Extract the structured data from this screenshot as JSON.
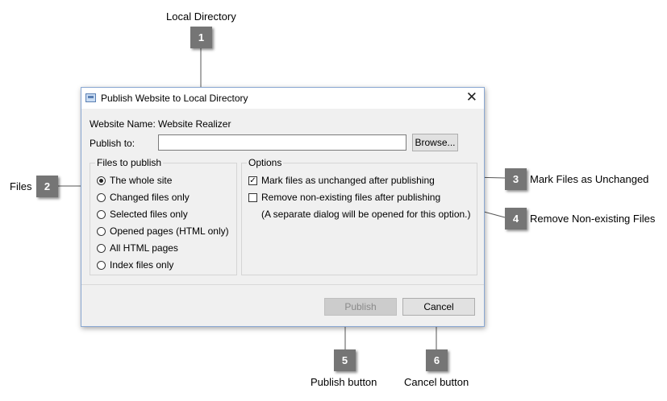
{
  "callouts": {
    "local_directory": {
      "number": "1",
      "text": "Local Directory"
    },
    "files": {
      "number": "2",
      "text": "Files"
    },
    "mark_unchanged": {
      "number": "3",
      "text": "Mark Files as Unchanged"
    },
    "remove_nonexisting": {
      "number": "4",
      "text": "Remove Non-existing Files"
    },
    "publish_button": {
      "number": "5",
      "text": "Publish button"
    },
    "cancel_button": {
      "number": "6",
      "text": "Cancel button"
    }
  },
  "dialog": {
    "title": "Publish Website to Local Directory",
    "close_symbol": "✕",
    "website_name_label": "Website Name:",
    "website_name_value": "Website Realizer",
    "publish_to_label": "Publish to:",
    "publish_to_value": "",
    "browse_label": "Browse...",
    "files_group": {
      "title": "Files to publish",
      "options": [
        {
          "label": "The whole site",
          "checked": true
        },
        {
          "label": "Changed files only",
          "checked": false
        },
        {
          "label": "Selected files only",
          "checked": false
        },
        {
          "label": "Opened pages (HTML only)",
          "checked": false
        },
        {
          "label": "All HTML pages",
          "checked": false
        },
        {
          "label": "Index files only",
          "checked": false
        }
      ]
    },
    "options_group": {
      "title": "Options",
      "mark_unchanged_label": "Mark files as unchanged after publishing",
      "mark_unchanged_checked": true,
      "remove_nonexisting_label": "Remove non-existing files after publishing",
      "remove_nonexisting_checked": false,
      "note": "(A separate dialog will be opened for this option.)"
    },
    "publish_label": "Publish",
    "cancel_label": "Cancel"
  }
}
